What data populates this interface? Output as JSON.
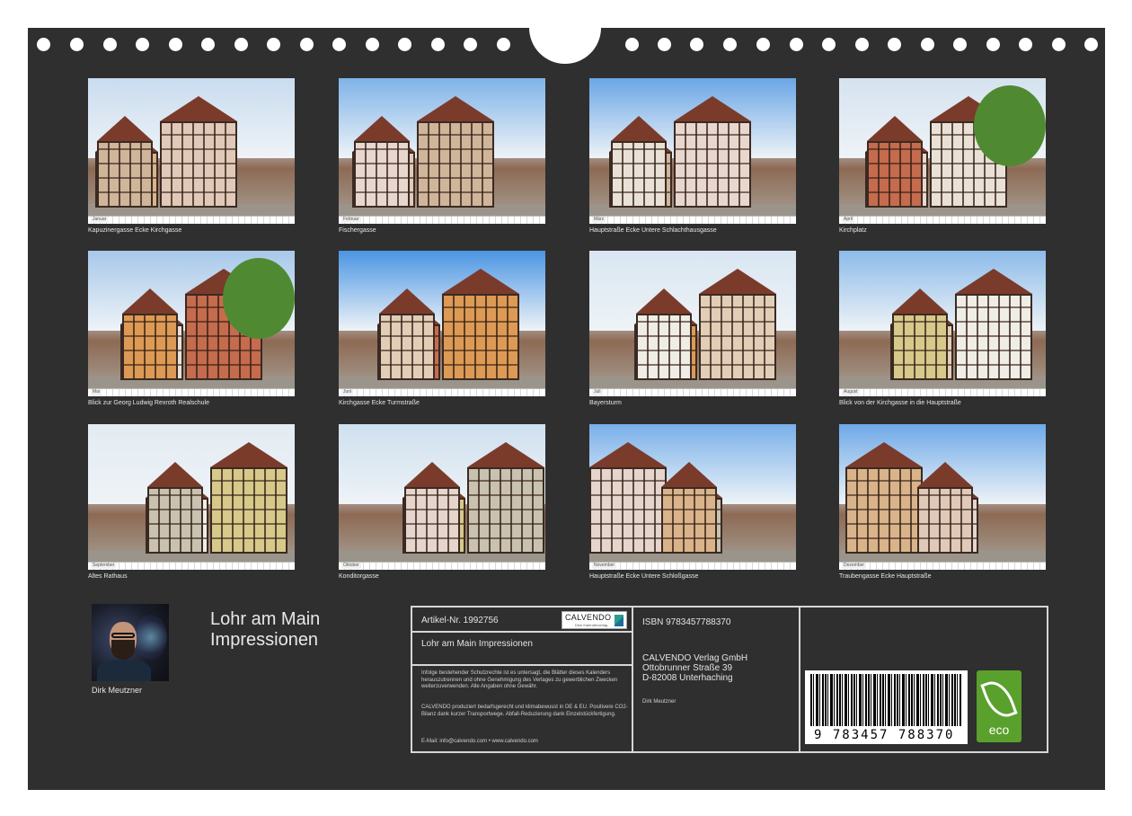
{
  "photos": [
    {
      "caption": "Kapuzinergasse Ecke Kirchgasse",
      "month": "Januar"
    },
    {
      "caption": "Fischergasse",
      "month": "Februar"
    },
    {
      "caption": "Hauptstraße Ecke Untere Schlachthausgasse",
      "month": "März"
    },
    {
      "caption": "Kirchplatz",
      "month": "April"
    },
    {
      "caption": "Blick zur Georg Ludwig Rexroth Realschule",
      "month": "Mai"
    },
    {
      "caption": "Kirchgasse Ecke Turmstraße",
      "month": "Juni"
    },
    {
      "caption": "Bayersturm",
      "month": "Juli"
    },
    {
      "caption": "Blick von der Kirchgasse in die Hauptstraße",
      "month": "August"
    },
    {
      "caption": "Altes Rathaus",
      "month": "September"
    },
    {
      "caption": "Konditorgasse",
      "month": "Oktober"
    },
    {
      "caption": "Hauptstraße Ecke Untere Schloßgasse",
      "month": "November"
    },
    {
      "caption": "Traubengasse Ecke Hauptstraße",
      "month": "Dezember"
    }
  ],
  "author": {
    "name": "Dirk Meutzner"
  },
  "calendar": {
    "title_line1": "Lohr am Main",
    "title_line2": "Impressionen"
  },
  "info": {
    "article": "Artikel-Nr. 1992756",
    "logo_brand": "CALVENDO",
    "logo_claim": "Dein Kalenderverlag",
    "title": "Lohr am Main Impressionen",
    "legal1": "Infolge bestehender Schutzrechte ist es untersagt, die Blätter dieses Kalenders herauszutrennen und ohne Genehmigung des Verlages zu gewerblichen Zwecken weiterzuverwenden. Alle Angaben ohne Gewähr.",
    "legal2": "CALVENDO produziert bedarfsgerecht und klimabewusst in DE & EU. Positivere CO2-Bilanz dank kurzer Transportwege. Abfall-Reduzierung dank Einzelstückfertigung.",
    "contact": "E-Mail: info@calvendo.com • www.calvendo.com",
    "isbn": "ISBN 9783457788370",
    "publisher1": "CALVENDO Verlag GmbH",
    "publisher2": "Ottobrunner Straße 39",
    "publisher3": "D-82008 Unterhaching",
    "author": "Dirk Meutzner",
    "barcode_number": "9 783457 788370",
    "eco_label": "eco"
  }
}
